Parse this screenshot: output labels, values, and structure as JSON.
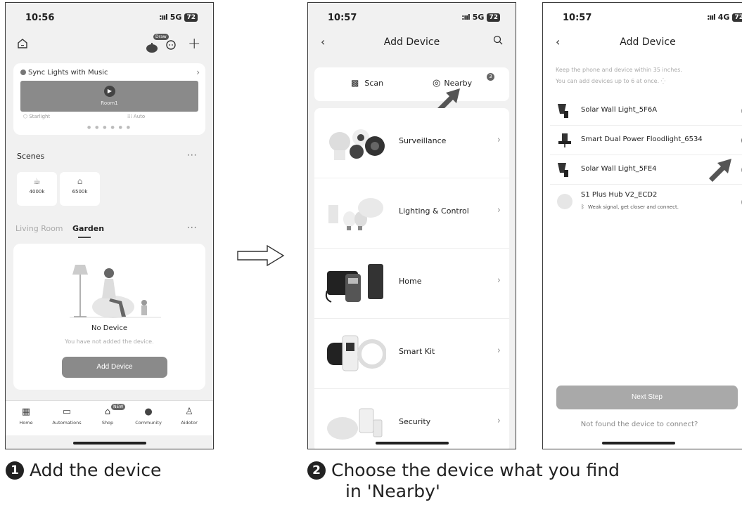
{
  "step1": {
    "status": {
      "time": "10:56",
      "network": "5G",
      "battery": "72"
    },
    "draw_label": "Draw",
    "music": {
      "title": "Sync Lights with Music",
      "room": "Room1",
      "left_label": "Starlight",
      "right_label": "Auto"
    },
    "scenes": {
      "title": "Scenes",
      "items": [
        "4000k",
        "6500k"
      ]
    },
    "rooms": {
      "inactive": "Living Room",
      "active": "Garden"
    },
    "empty": {
      "title": "No Device",
      "subtitle": "You have not added the device.",
      "button": "Add Device"
    },
    "tabs": [
      "Home",
      "Automations",
      "Shop",
      "Community",
      "Aidotor"
    ],
    "new_badge": "NEW"
  },
  "step2": {
    "status": {
      "time": "10:57",
      "network": "5G",
      "battery": "72"
    },
    "title": "Add Device",
    "segments": {
      "scan": "Scan",
      "nearby": "Nearby",
      "nearby_count": "3"
    },
    "categories": [
      "Surveillance",
      "Lighting & Control",
      "Home",
      "Smart Kit",
      "Security"
    ]
  },
  "step3": {
    "status": {
      "time": "10:57",
      "network": "4G",
      "battery": "72"
    },
    "title": "Add Device",
    "hint_line1": "Keep the phone and device within 35 inches.",
    "hint_line2": "You can add devices up to 6 at once.",
    "devices": [
      {
        "name": "Solar Wall Light_5F6A",
        "checked": false
      },
      {
        "name": "Smart Dual Power Floodlight_6534",
        "checked": true
      },
      {
        "name": "Solar Wall Light_5FE4",
        "checked": false
      },
      {
        "name": "S1 Plus Hub V2_ECD2",
        "checked": false,
        "sub": "Weak signal, get closer and connect."
      }
    ],
    "next_button": "Next Step",
    "not_found": "Not found the device to connect?"
  },
  "captions": {
    "step1_num": "1",
    "step1": "Add the device",
    "step2_num": "2",
    "step2_line1": "Choose the device what you find",
    "step2_line2": "in 'Nearby'"
  }
}
